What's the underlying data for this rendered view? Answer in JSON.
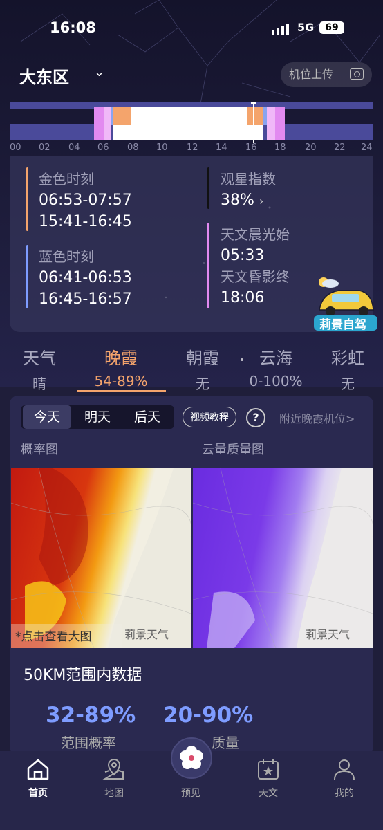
{
  "status": {
    "time": "16:08",
    "network": "5G",
    "battery": "69"
  },
  "header": {
    "location": "大东区",
    "upload_label": "机位上传"
  },
  "timeline": {
    "ticks": [
      "00",
      "02",
      "04",
      "06",
      "08",
      "10",
      "12",
      "14",
      "16",
      "18",
      "20",
      "22",
      "24"
    ]
  },
  "info": {
    "golden": {
      "label": "金色时刻",
      "times": [
        "06:53-07:57",
        "15:41-16:45"
      ]
    },
    "blue": {
      "label": "蓝色时刻",
      "times": [
        "06:41-06:53",
        "16:45-16:57"
      ]
    },
    "stargazing": {
      "label": "观星指数",
      "value": "38%"
    },
    "dawn": {
      "label": "天文晨光始",
      "value": "05:33"
    },
    "dusk": {
      "label": "天文昏影终",
      "value": "18:06"
    },
    "logo_text": "莉景自驾"
  },
  "tabs": [
    {
      "title": "天气",
      "value": "晴"
    },
    {
      "title": "晚霞",
      "value": "54-89%"
    },
    {
      "title": "朝霞",
      "value": "无"
    },
    {
      "title": "云海",
      "value": "0-100%"
    },
    {
      "title": "彩虹",
      "value": "无"
    }
  ],
  "panel": {
    "days": [
      "今天",
      "明天",
      "后天"
    ],
    "video_label": "视频教程",
    "help_label": "?",
    "nearby_label": "附近晚霞机位>",
    "map_left_label": "概率图",
    "map_right_label": "云量质量图",
    "hint": "*点击查看大图",
    "watermark": "莉景天气",
    "range_title": "50KM范围内数据",
    "prob_value": "32-89%",
    "prob_label": "范围概率",
    "quality_value": "20-90%",
    "quality_label": "质量"
  },
  "nav": [
    "首页",
    "地图",
    "预见",
    "天文",
    "我的"
  ]
}
